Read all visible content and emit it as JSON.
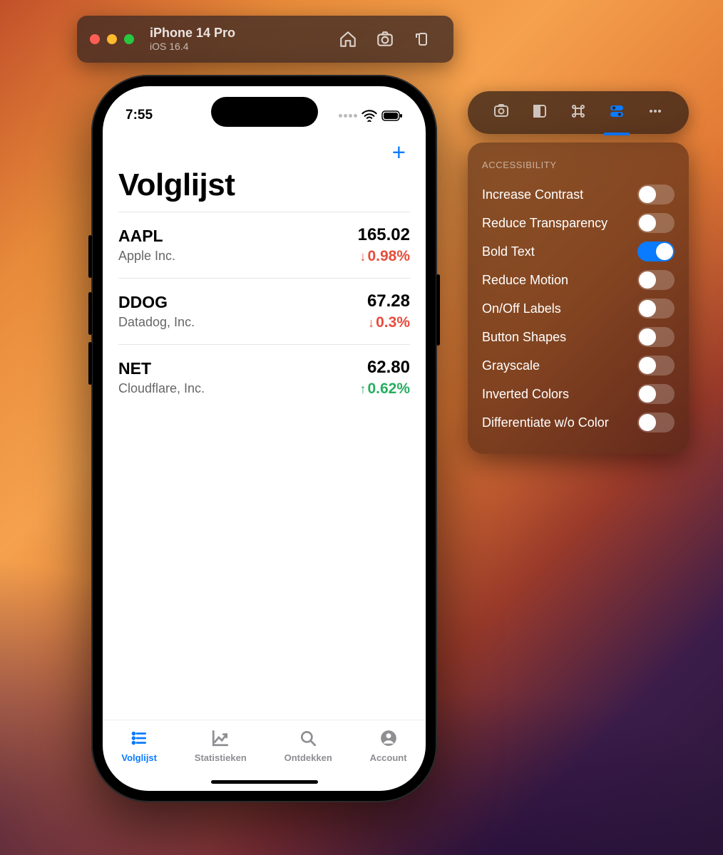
{
  "simulator": {
    "device": "iPhone 14 Pro",
    "os": "iOS 16.4"
  },
  "phone": {
    "time": "7:55",
    "title": "Volglijst",
    "tabs": [
      {
        "label": "Volglijst",
        "active": true
      },
      {
        "label": "Statistieken",
        "active": false
      },
      {
        "label": "Ontdekken",
        "active": false
      },
      {
        "label": "Account",
        "active": false
      }
    ],
    "stocks": [
      {
        "symbol": "AAPL",
        "company": "Apple Inc.",
        "price": "165.02",
        "change": "0.98%",
        "dir": "down"
      },
      {
        "symbol": "DDOG",
        "company": "Datadog, Inc.",
        "price": "67.28",
        "change": "0.3%",
        "dir": "down"
      },
      {
        "symbol": "NET",
        "company": "Cloudflare, Inc.",
        "price": "62.80",
        "change": "0.62%",
        "dir": "up"
      }
    ]
  },
  "accessibility": {
    "heading": "ACCESSIBILITY",
    "options": [
      {
        "label": "Increase Contrast",
        "on": false
      },
      {
        "label": "Reduce Transparency",
        "on": false
      },
      {
        "label": "Bold Text",
        "on": true
      },
      {
        "label": "Reduce Motion",
        "on": false
      },
      {
        "label": "On/Off Labels",
        "on": false
      },
      {
        "label": "Button Shapes",
        "on": false
      },
      {
        "label": "Grayscale",
        "on": false
      },
      {
        "label": "Inverted Colors",
        "on": false
      },
      {
        "label": "Differentiate w/o Color",
        "on": false
      }
    ]
  }
}
